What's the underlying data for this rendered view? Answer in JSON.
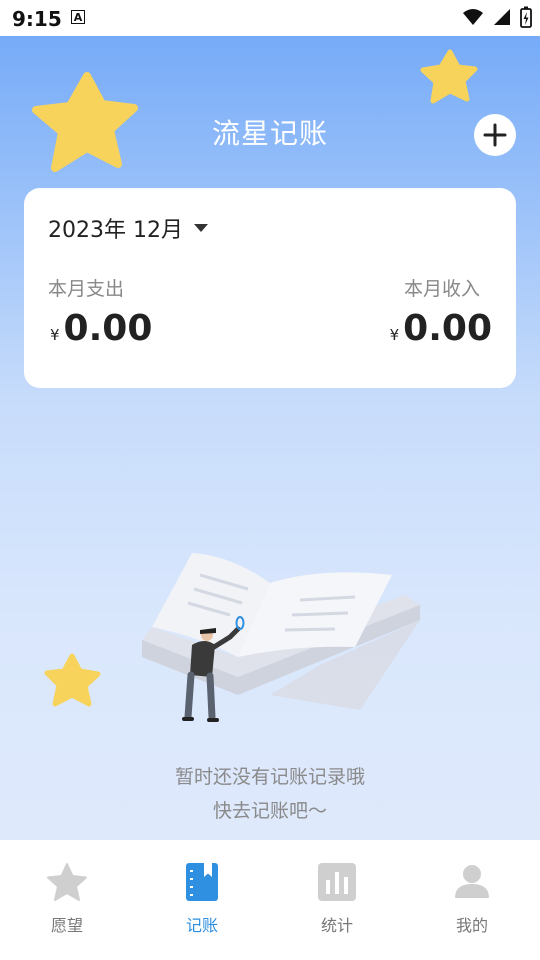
{
  "status_bar": {
    "time": "9:15",
    "notification_icon": "A"
  },
  "header": {
    "title": "流星记账",
    "add_icon": "plus-icon"
  },
  "summary_card": {
    "month_selector": "2023年 12月",
    "expense_label": "本月支出",
    "income_label": "本月收入",
    "currency_symbol": "¥",
    "expense_value": "0.00",
    "income_value": "0.00"
  },
  "empty_state": {
    "line1": "暂时还没有记账记录哦",
    "line2": "快去记账吧～"
  },
  "bottom_nav": {
    "items": [
      {
        "label": "愿望",
        "icon": "star-icon",
        "active": false
      },
      {
        "label": "记账",
        "icon": "book-icon",
        "active": true
      },
      {
        "label": "统计",
        "icon": "chart-icon",
        "active": false
      },
      {
        "label": "我的",
        "icon": "user-icon",
        "active": false
      }
    ]
  },
  "colors": {
    "accent": "#2f8fe0",
    "header_gradient_top": "#6fa6f7",
    "star": "#f7d35b"
  }
}
